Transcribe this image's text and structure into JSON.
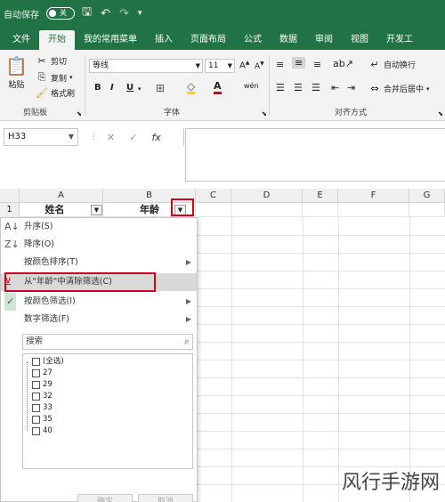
{
  "titlebar": {
    "autosave": "自动保存",
    "toggle": "关",
    "save": "🖫",
    "undo": "↶",
    "redo": "↷",
    "more": "▾"
  },
  "tabs": [
    "文件",
    "开始",
    "我的常用菜单",
    "插入",
    "页面布局",
    "公式",
    "数据",
    "审阅",
    "视图",
    "开发工"
  ],
  "ribbon": {
    "paste": "粘贴",
    "cut": "剪切",
    "copy": "复制",
    "format_painter": "格式刷",
    "clipboard": "剪贴板",
    "font_name": "等线",
    "font_size": "11",
    "font_group": "字体",
    "bold": "B",
    "italic": "I",
    "underline": "U",
    "auto_wrap": "自动换行",
    "merge_center": "合并后居中",
    "alignment": "对齐方式",
    "phonetic": "wén"
  },
  "formula_bar": {
    "name_box": "H33",
    "cancel": "✕",
    "enter": "✓",
    "fx": "fx"
  },
  "columns": [
    "A",
    "B",
    "C",
    "D",
    "E",
    "F",
    "G"
  ],
  "row1": {
    "num": "1",
    "a": "姓名",
    "b": "年龄"
  },
  "menu": {
    "sort_asc": "升序(S)",
    "sort_desc": "降序(O)",
    "sort_by_color": "按颜色排序(T)",
    "clear_filter": "从\"年龄\"中清除筛选(C)",
    "filter_by_color": "按颜色筛选(I)",
    "number_filter": "数字筛选(F)",
    "search_placeholder": "搜索",
    "items": [
      "(全选)",
      "27",
      "29",
      "32",
      "33",
      "35",
      "40"
    ],
    "ok": "确定",
    "cancel": "取消"
  },
  "watermark": "风行手游网"
}
